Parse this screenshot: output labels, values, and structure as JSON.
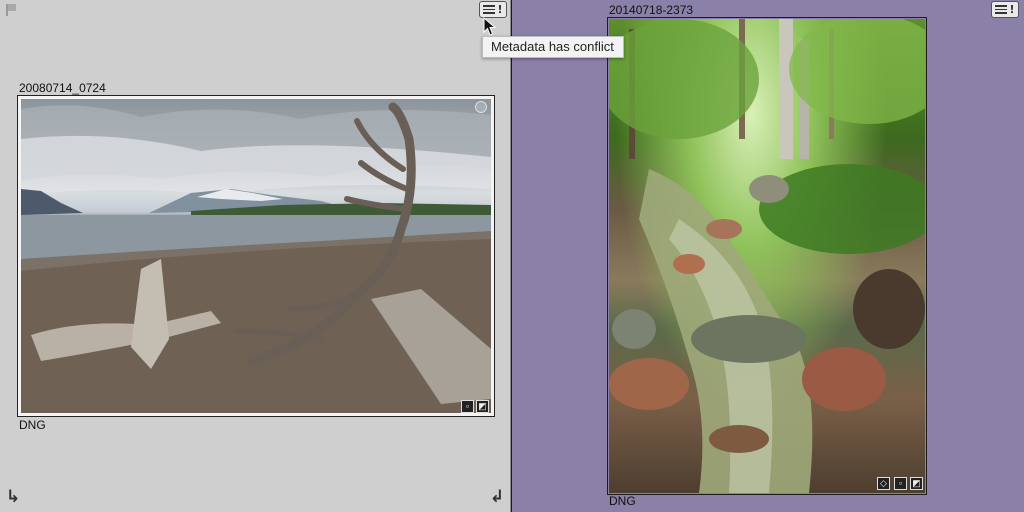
{
  "left_cell": {
    "filename": "20080714_0724",
    "file_type": "DNG",
    "flag_icon": "flag-icon",
    "metadata_icon": "metadata-badge-icon",
    "rotate_left_icon": "rotate-left-icon",
    "rotate_right_icon": "rotate-right-icon"
  },
  "right_cell": {
    "filename": "20140718-2373",
    "file_type": "DNG",
    "metadata_icon": "metadata-badge-icon"
  },
  "tooltip": {
    "text": "Metadata has conflict"
  },
  "colors": {
    "left_cell_bg": "#cfcfcf",
    "right_cell_bg_selected": "#8a80a8"
  }
}
